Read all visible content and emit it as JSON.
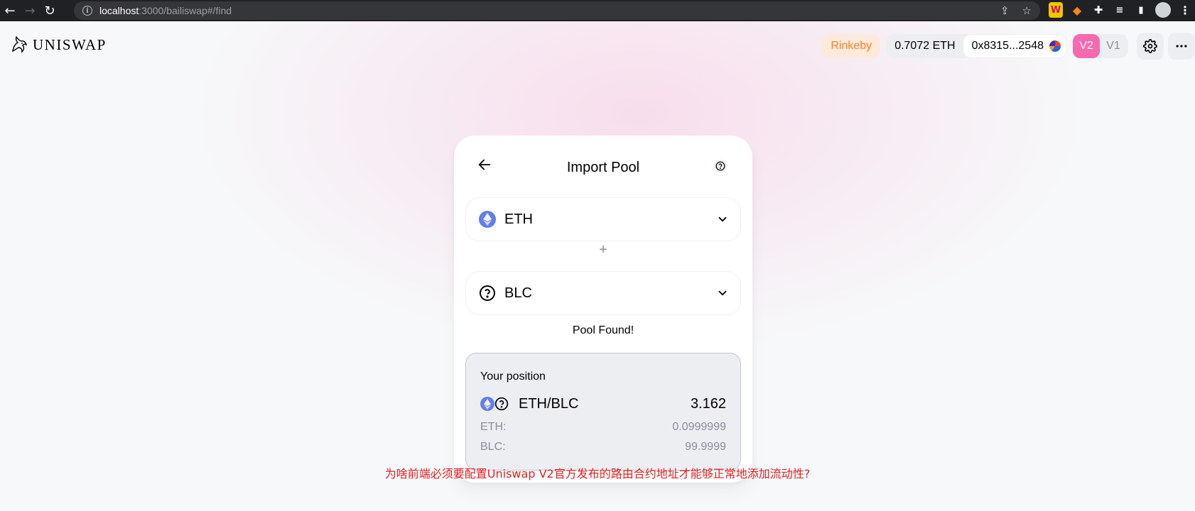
{
  "browser": {
    "url_host": "localhost",
    "url_path": ":3000/bailiswap#/find"
  },
  "header": {
    "logo_text": "UNISWAP",
    "network": "Rinkeby",
    "balance": "0.7072 ETH",
    "address": "0x8315...2548",
    "version_active": "V2",
    "version_inactive": "V1"
  },
  "card": {
    "title": "Import Pool",
    "token0": {
      "symbol": "ETH",
      "icon": "eth-icon"
    },
    "plus": "+",
    "token1": {
      "symbol": "BLC",
      "icon": "question-icon"
    },
    "status": "Pool Found!",
    "position": {
      "title": "Your position",
      "pair": "ETH/BLC",
      "pool_tokens": "3.162",
      "rows": [
        {
          "label": "ETH:",
          "value": "0.0999999"
        },
        {
          "label": "BLC:",
          "value": "99.9999"
        }
      ]
    }
  },
  "footer_note": "为啥前端必须要配置Uniswap V2官方发布的路由合约地址才能够正常地添加流动性?",
  "colors": {
    "accent_pink": "#ff007a",
    "network_orange": "#f3841e",
    "eth_blue": "#627eea",
    "note_red": "#e02020"
  }
}
